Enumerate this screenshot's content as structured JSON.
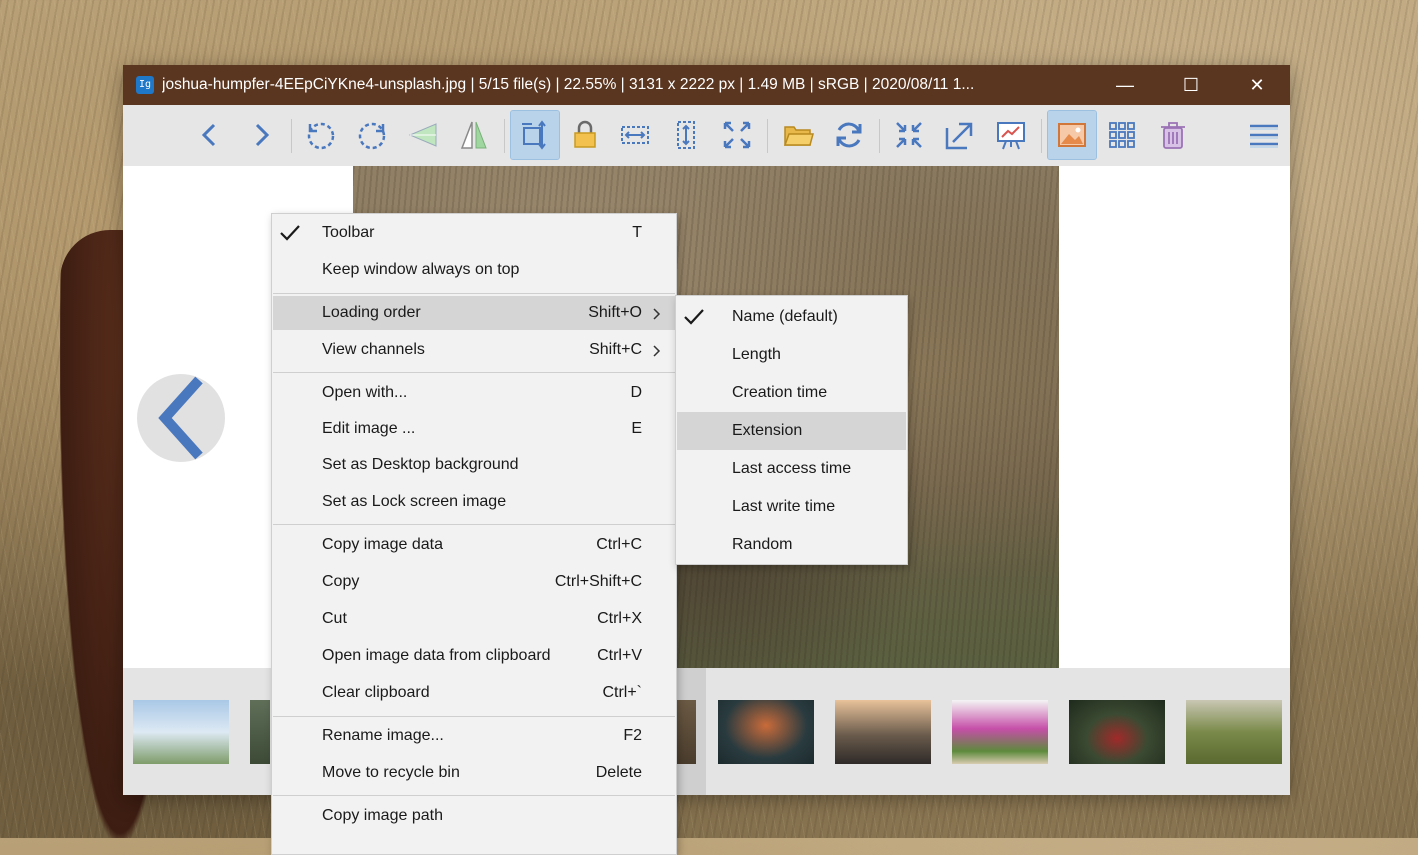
{
  "window": {
    "title": "joshua-humpfer-4EEpCiYKne4-unsplash.jpg  |  5/15 file(s)  |  22.55%  |  3131 x 2222 px  |  1.49 MB  |  sRGB  |  2020/08/11 1...",
    "app_icon_text": "Ig",
    "minimize": "—",
    "maximize": "☐",
    "close": "✕"
  },
  "toolbar": {
    "icons": [
      "back-icon",
      "forward-icon",
      "rotate-left-icon",
      "rotate-right-icon",
      "flip-horizontal-icon",
      "flip-vertical-icon",
      "auto-fit-icon",
      "lock-zoom-icon",
      "fit-width-icon",
      "fit-height-icon",
      "full-screen-icon",
      "open-file-icon",
      "refresh-icon",
      "actual-size-icon",
      "open-with-icon",
      "slideshow-icon",
      "gallery-icon",
      "thumbnail-grid-icon",
      "recycle-bin-icon",
      "main-menu-icon"
    ],
    "active": [
      "auto-fit-icon",
      "gallery-icon"
    ]
  },
  "context_menu": {
    "items": [
      {
        "label": "Toolbar",
        "shortcut": "T",
        "checked": true
      },
      {
        "label": "Keep window always on top",
        "shortcut": ""
      },
      {
        "label": "Loading order",
        "shortcut": "Shift+O",
        "submenu": true,
        "highlighted": true
      },
      {
        "label": "View channels",
        "shortcut": "Shift+C",
        "submenu": true
      },
      {
        "label": "Open with...",
        "shortcut": "D"
      },
      {
        "label": "Edit image ...",
        "shortcut": "E"
      },
      {
        "label": "Set as Desktop background",
        "shortcut": ""
      },
      {
        "label": "Set as Lock screen image",
        "shortcut": ""
      },
      {
        "label": "Copy image data",
        "shortcut": "Ctrl+C"
      },
      {
        "label": "Copy",
        "shortcut": "Ctrl+Shift+C"
      },
      {
        "label": "Cut",
        "shortcut": "Ctrl+X"
      },
      {
        "label": "Open image data from clipboard",
        "shortcut": "Ctrl+V"
      },
      {
        "label": "Clear clipboard",
        "shortcut": "Ctrl+`"
      },
      {
        "label": "Rename image...",
        "shortcut": "F2"
      },
      {
        "label": "Move to recycle bin",
        "shortcut": "Delete"
      },
      {
        "label": "Copy image path",
        "shortcut": ""
      }
    ]
  },
  "loading_order_submenu": {
    "items": [
      {
        "label": "Name (default)",
        "checked": true
      },
      {
        "label": "Length"
      },
      {
        "label": "Creation time"
      },
      {
        "label": "Extension",
        "highlighted": true
      },
      {
        "label": "Last access time"
      },
      {
        "label": "Last write time"
      },
      {
        "label": "Random"
      }
    ]
  },
  "colors": {
    "titlebar": "#5a3520",
    "toolbar_bg": "#e6e6e6",
    "accent_blue": "#4a78bf",
    "menu_bg": "#f2f2f2",
    "menu_highlight": "#d5d5d5"
  }
}
